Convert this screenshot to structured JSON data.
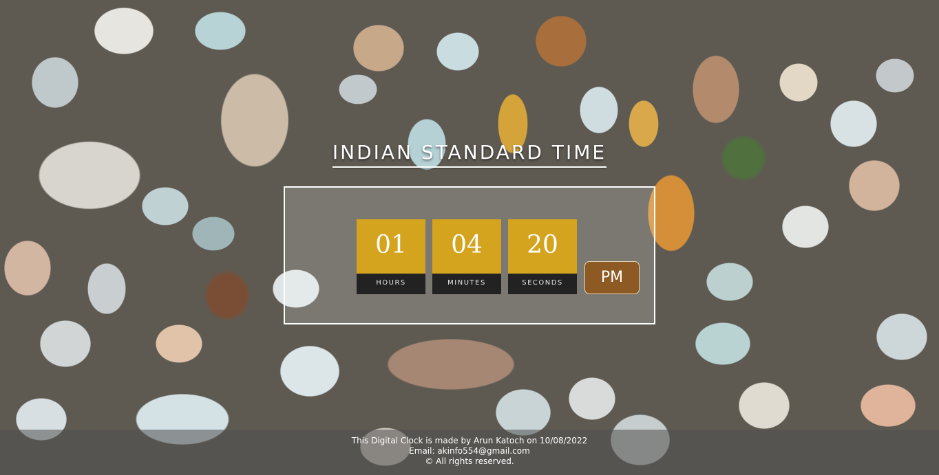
{
  "page": {
    "title": "INDIAN STANDARD TIME"
  },
  "clock": {
    "hours": {
      "value": "01",
      "label": "HOURS"
    },
    "minutes": {
      "value": "04",
      "label": "MINUTES"
    },
    "seconds": {
      "value": "20",
      "label": "SECONDS"
    },
    "period": "PM",
    "colors": {
      "digit_bg": "#d4a41f",
      "label_bg": "#222222",
      "period_bg": "#8d5a23"
    }
  },
  "footer": {
    "line1": "This Digital Clock is made by Arun Katoch on 10/08/2022",
    "line2": "Email: akinfo554@gmail.com",
    "line3": "© All rights reserved."
  }
}
